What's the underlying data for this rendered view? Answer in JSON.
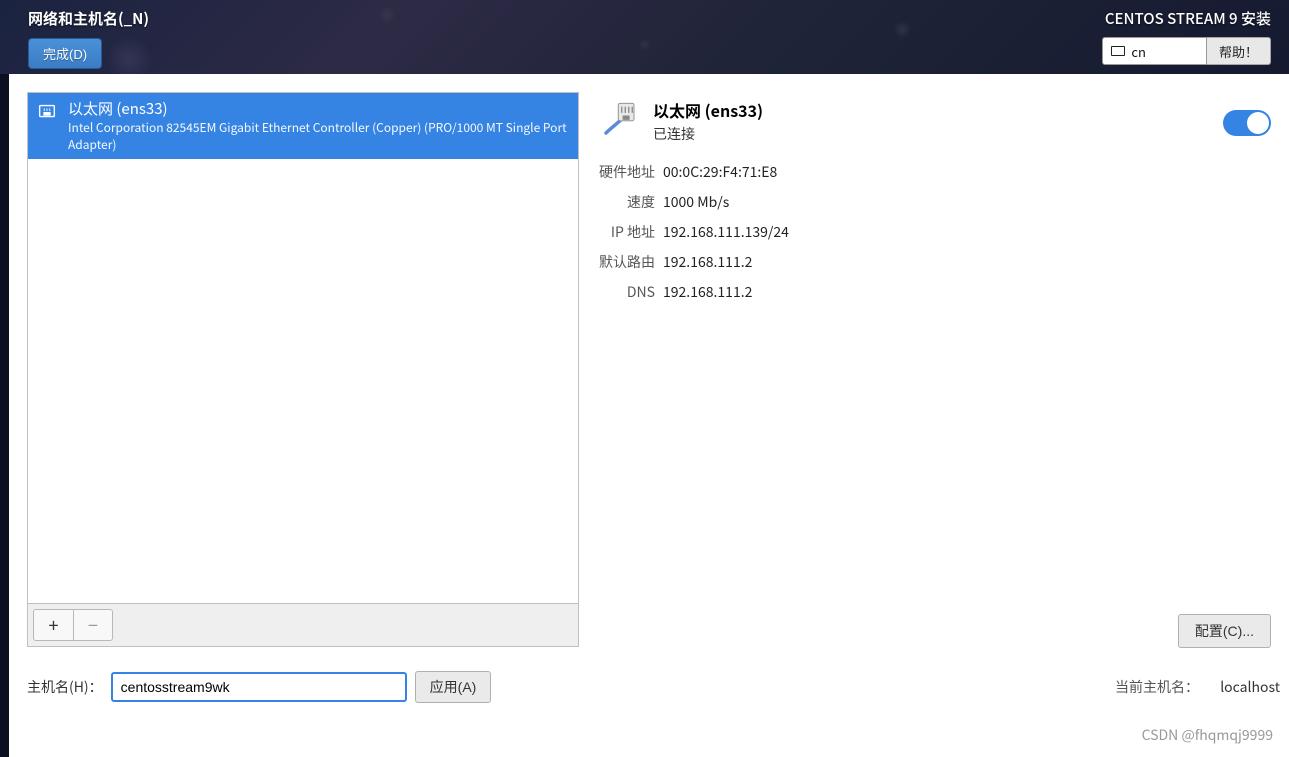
{
  "header": {
    "title": "网络和主机名(_N)",
    "done_button": "完成(D)",
    "install_title": "CENTOS STREAM 9 安装",
    "lang": "cn",
    "help_button": "帮助！"
  },
  "device_list": {
    "items": [
      {
        "name": "以太网 (ens33)",
        "description": "Intel Corporation 82545EM Gigabit Ethernet Controller (Copper) (PRO/1000 MT Single Port Adapter)"
      }
    ],
    "add_label": "+",
    "remove_label": "−"
  },
  "connection": {
    "title": "以太网 (ens33)",
    "status": "已连接",
    "toggle_on": true,
    "details": {
      "hw_addr_label": "硬件地址",
      "hw_addr": "00:0C:29:F4:71:E8",
      "speed_label": "速度",
      "speed": "1000 Mb/s",
      "ip_label": "IP 地址",
      "ip": "192.168.111.139/24",
      "gateway_label": "默认路由",
      "gateway": "192.168.111.2",
      "dns_label": "DNS",
      "dns": "192.168.111.2"
    },
    "configure_button": "配置(C)..."
  },
  "hostname": {
    "label": "主机名(H)：",
    "value": "centosstream9wk",
    "apply_button": "应用(A)",
    "current_label": "当前主机名：",
    "current_value": "localhost"
  },
  "watermark": "CSDN @fhqmqj9999"
}
